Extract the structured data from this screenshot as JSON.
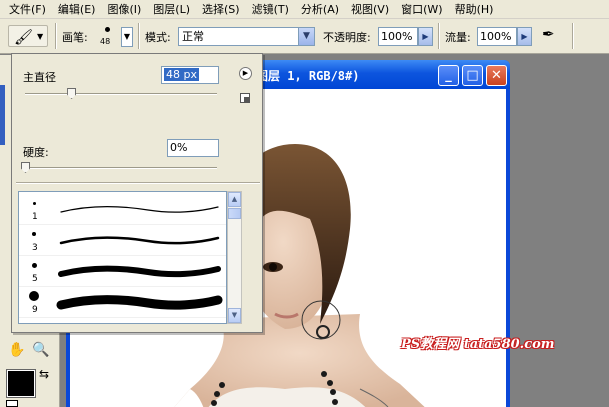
{
  "menubar": {
    "items": [
      "文件(F)",
      "编辑(E)",
      "图像(I)",
      "图层(L)",
      "选择(S)",
      "滤镜(T)",
      "分析(A)",
      "视图(V)",
      "窗口(W)",
      "帮助(H)"
    ]
  },
  "options_bar": {
    "brush_label": "画笔:",
    "brush_size": "48",
    "mode_label": "模式:",
    "mode_value": "正常",
    "opacity_label": "不透明度:",
    "opacity_value": "100%",
    "flow_label": "流量:",
    "flow_value": "100%",
    "tool_icon": "brush-icon",
    "airbrush_icon": "airbrush-icon"
  },
  "document": {
    "title": "图层 1, RGB/8#)",
    "minimize": "_",
    "maximize": "□",
    "close": "✕"
  },
  "brush_popup": {
    "master_diameter_label": "主直径",
    "master_diameter_value": "48 px",
    "master_diameter_fraction": 0.24,
    "hardness_label": "硬度:",
    "hardness_value": "0%",
    "hardness_fraction": 0.0,
    "brushes": [
      {
        "size": "1",
        "dot": 1.5,
        "stroke": 1.2
      },
      {
        "size": "3",
        "dot": 2,
        "stroke": 2.5
      },
      {
        "size": "5",
        "dot": 2.5,
        "stroke": 6
      },
      {
        "size": "9",
        "dot": 5,
        "stroke": 9
      }
    ]
  },
  "watermark": "PS教程网 tata580.com"
}
